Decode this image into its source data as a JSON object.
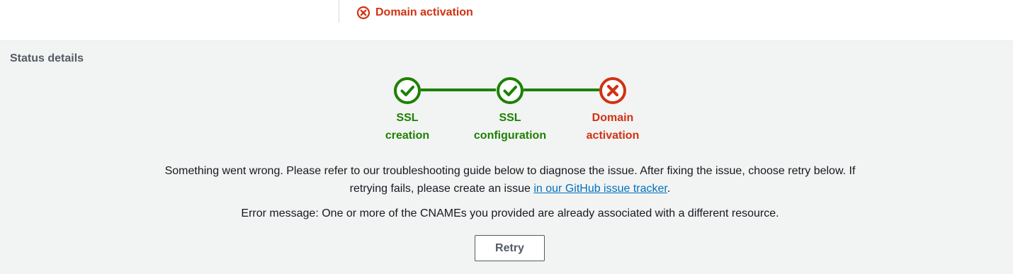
{
  "header": {
    "status_label": "Domain activation",
    "status_icon": "error-circle-icon"
  },
  "status_details": {
    "title": "Status details",
    "steps": [
      {
        "line1": "SSL",
        "line2": "creation",
        "state": "success",
        "icon": "check-circle-icon"
      },
      {
        "line1": "SSL",
        "line2": "configuration",
        "state": "success",
        "icon": "check-circle-icon"
      },
      {
        "line1": "Domain",
        "line2": "activation",
        "state": "error",
        "icon": "error-circle-icon"
      }
    ],
    "message_text": "Something went wrong. Please refer to our troubleshooting guide below to diagnose the issue. After fixing the issue, choose retry below. If retrying fails, please create an issue ",
    "message_link": "in our GitHub issue tracker",
    "message_end": ".",
    "error_message": "Error message: One or more of the CNAMEs you provided are already associated with a different resource.",
    "retry_label": "Retry"
  },
  "colors": {
    "success": "#1d8102",
    "error": "#d13212",
    "link": "#0073bb",
    "panel_bg": "#f2f3f3"
  }
}
